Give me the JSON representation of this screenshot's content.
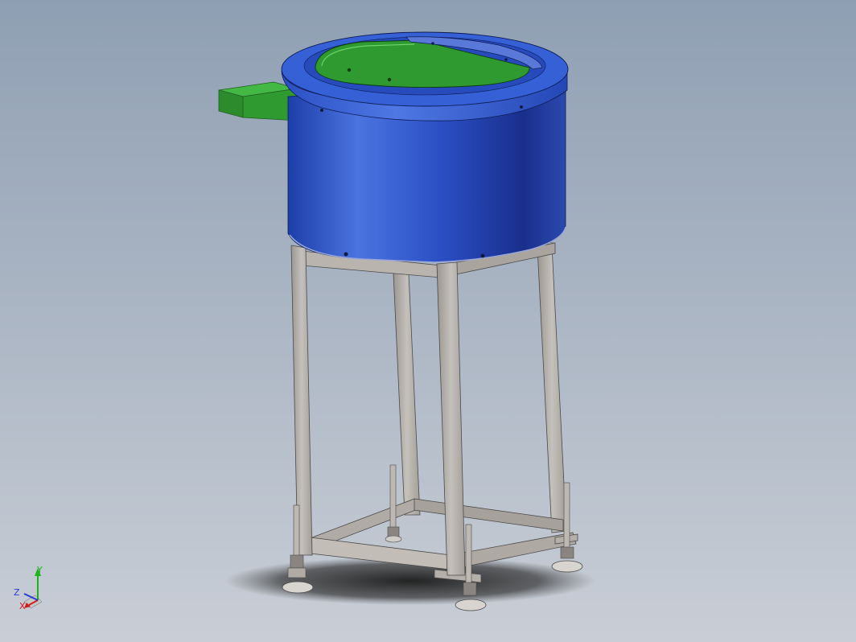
{
  "app": {
    "type": "cad-viewport"
  },
  "colors": {
    "background_top": "#8f9fb3",
    "background_bottom": "#c9ced6",
    "bowl_blue": "#2a4fc4",
    "bowl_blue_dark": "#16318c",
    "bowl_blue_light": "#4b74e0",
    "plate_green": "#2f9a2f",
    "plate_green_light": "#44b844",
    "chute_green": "#2c8c2c",
    "frame_gray": "#b7b2ad",
    "frame_gray_dark": "#8e8984",
    "axis_x": "#d41c1c",
    "axis_y": "#1cb41c",
    "axis_z": "#2a3ad4"
  },
  "triad": {
    "x_label": "X",
    "y_label": "Y",
    "z_label": "Z"
  },
  "model": {
    "parts": [
      "vibratory-bowl",
      "bowl-top-plate",
      "discharge-chute",
      "support-frame",
      "leveling-feet"
    ]
  }
}
